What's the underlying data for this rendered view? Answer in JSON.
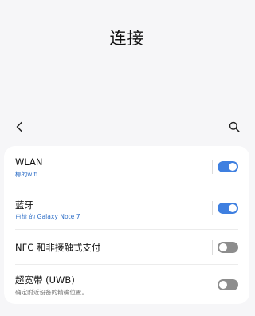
{
  "page": {
    "title": "连接"
  },
  "toolbar": {
    "back_icon": "chevron-left-icon",
    "search_icon": "search-icon"
  },
  "settings": [
    {
      "title": "WLAN",
      "subtitle": "椰的wifi",
      "subtitle_color": "#2f6fc7",
      "enabled": true
    },
    {
      "title": "蓝牙",
      "subtitle": "白给 的 Galaxy Note 7",
      "subtitle_color": "#2f6fc7",
      "enabled": true
    },
    {
      "title": "NFC 和非接触式支付",
      "subtitle": "",
      "enabled": false
    },
    {
      "title": "超宽带 (UWB)",
      "subtitle": "确定附近设备的精确位置。",
      "subtitle_color": "#7a7a7a",
      "enabled": false
    }
  ],
  "colors": {
    "background": "#f6f6f8",
    "card": "#ffffff",
    "toggle_on": "#3e7fe0",
    "toggle_off": "#8d8d8d"
  }
}
